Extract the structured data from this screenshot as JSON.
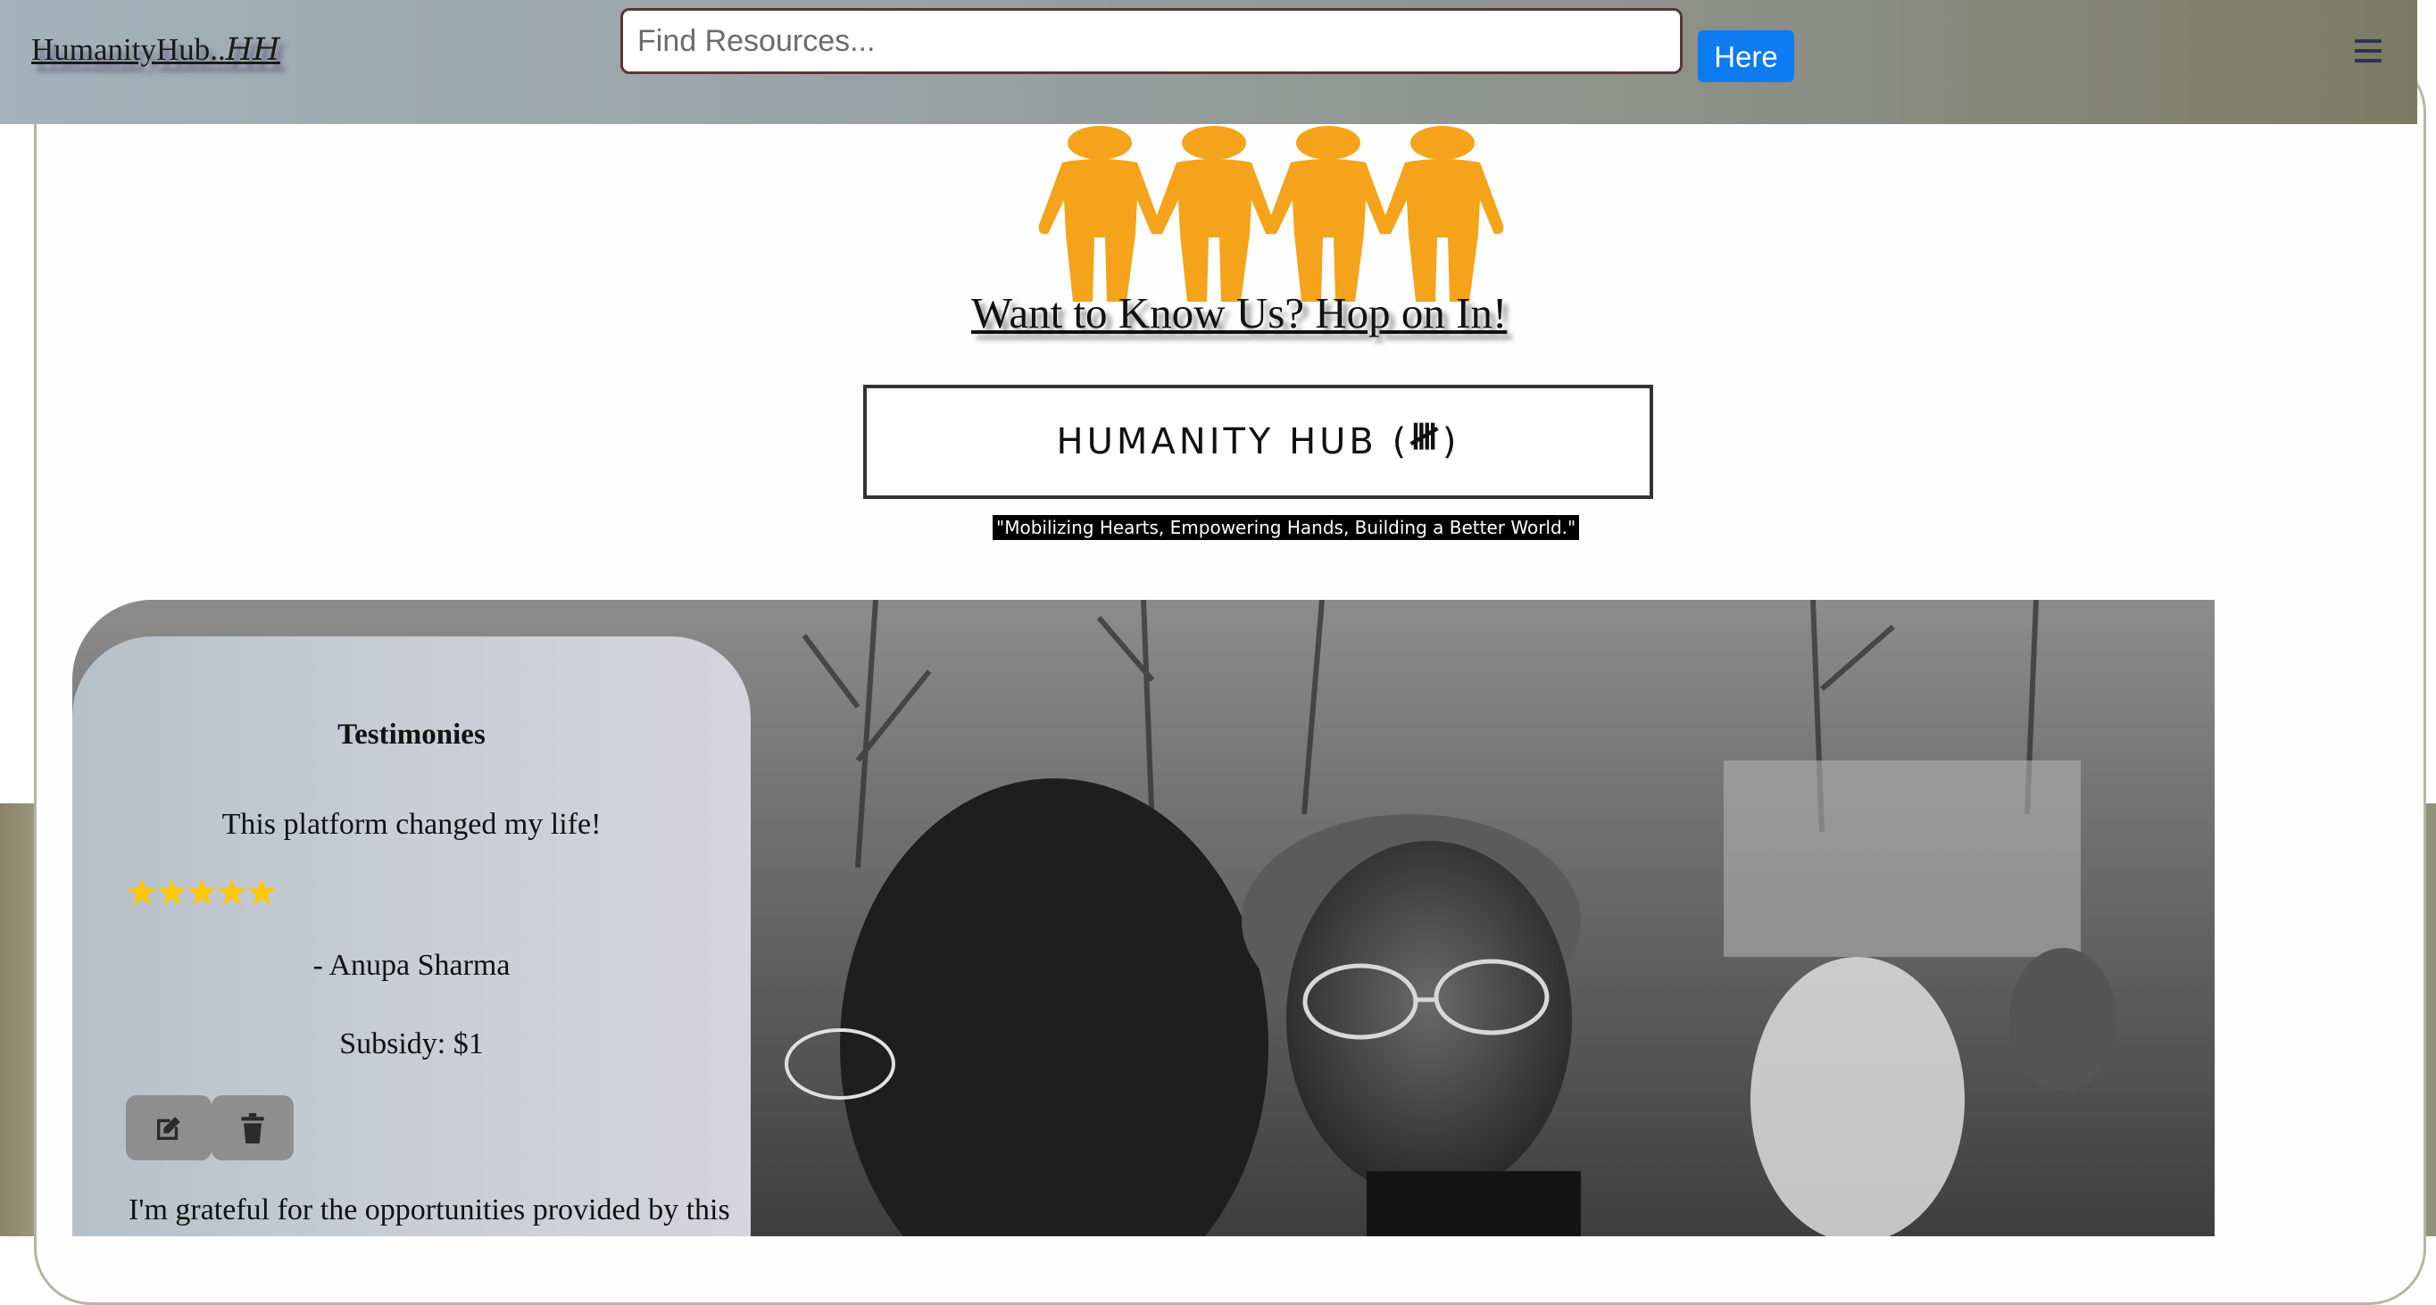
{
  "header": {
    "brand": "HumanityHub..",
    "brand_suffix": "HH",
    "search": {
      "placeholder": "Find Resources...",
      "value": ""
    },
    "search_button": "Here",
    "menu_icon": "hamburger-menu-icon"
  },
  "hero": {
    "icon": "people-holding-hands-icon",
    "link_text": "Want to Know Us? Hop on In!",
    "title": "HUMANITY HUB (",
    "title_logo": "𝍸",
    "title_close": ")",
    "slogan": "\"Mobilizing Hearts, Empowering Hands, Building a Better World.\""
  },
  "testimonials": {
    "heading": "Testimonies",
    "items": [
      {
        "quote": "This platform changed my life!",
        "rating": 5,
        "stars": "★★★★★",
        "author": "- Anupa Sharma",
        "subsidy": "Subsidy: $1",
        "actions": [
          "edit-icon",
          "trash-icon"
        ]
      },
      {
        "quote": "I'm grateful for the opportunities provided by this"
      }
    ]
  },
  "colors": {
    "accent_blue": "#0d7bf2",
    "people_icon": "#f5a31a",
    "star": "#ffc800"
  }
}
